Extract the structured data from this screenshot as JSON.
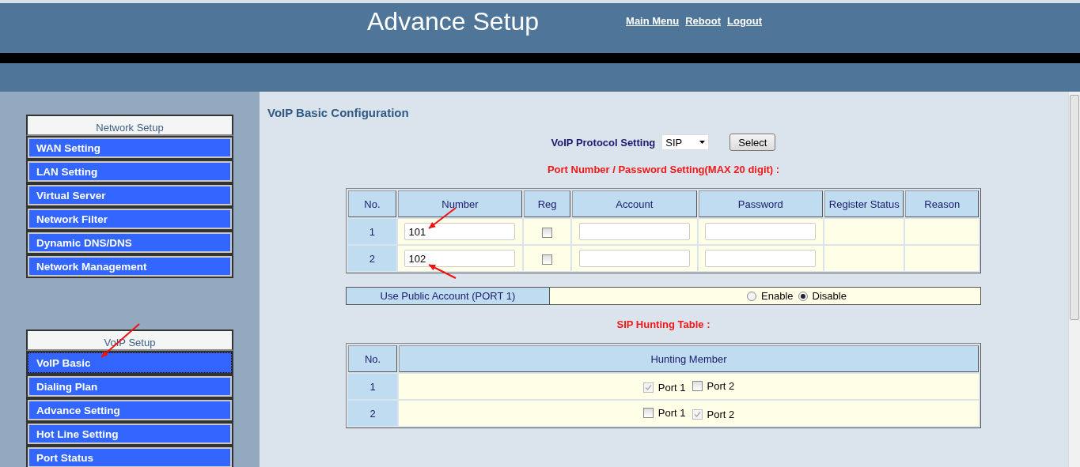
{
  "header": {
    "title": "Advance Setup",
    "links": [
      "Main Menu",
      "Reboot",
      "Logout"
    ]
  },
  "sidebar": {
    "groups": [
      {
        "title": "Network Setup",
        "items": [
          {
            "label": "WAN Setting",
            "selected": false
          },
          {
            "label": "LAN Setting",
            "selected": false
          },
          {
            "label": "Virtual Server",
            "selected": false
          },
          {
            "label": "Network Filter",
            "selected": false
          },
          {
            "label": "Dynamic DNS/DNS",
            "selected": false
          },
          {
            "label": "Network Management",
            "selected": false
          }
        ]
      },
      {
        "title": "VoIP Setup",
        "items": [
          {
            "label": "VoIP Basic",
            "selected": true
          },
          {
            "label": "Dialing Plan",
            "selected": false
          },
          {
            "label": "Advance Setting",
            "selected": false
          },
          {
            "label": "Hot Line Setting",
            "selected": false
          },
          {
            "label": "Port Status",
            "selected": false
          }
        ]
      }
    ]
  },
  "main": {
    "heading": "VoIP Basic Configuration",
    "protocol": {
      "label": "VoIP Protocol Setting",
      "value": "SIP",
      "button": "Select"
    },
    "port_table": {
      "title": "Port Number / Password Setting(MAX 20 digit) :",
      "columns": [
        "No.",
        "Number",
        "Reg",
        "Account",
        "Password",
        "Register Status",
        "Reason"
      ],
      "rows": [
        {
          "no": "1",
          "number": "101",
          "reg": false
        },
        {
          "no": "2",
          "number": "102",
          "reg": false
        }
      ]
    },
    "public_account": {
      "label": "Use Public Account (PORT 1)",
      "options": [
        {
          "label": "Enable",
          "selected": false
        },
        {
          "label": "Disable",
          "selected": true
        }
      ]
    },
    "hunting_table": {
      "title": "SIP Hunting Table :",
      "columns": [
        "No.",
        "Hunting Member"
      ],
      "rows": [
        {
          "no": "1",
          "members": [
            {
              "label": "Port 1",
              "checked": true,
              "disabled": true
            },
            {
              "label": "Port 2",
              "checked": false,
              "disabled": false
            }
          ]
        },
        {
          "no": "2",
          "members": [
            {
              "label": "Port 1",
              "checked": false,
              "disabled": false
            },
            {
              "label": "Port 2",
              "checked": true,
              "disabled": true
            }
          ]
        }
      ]
    }
  }
}
